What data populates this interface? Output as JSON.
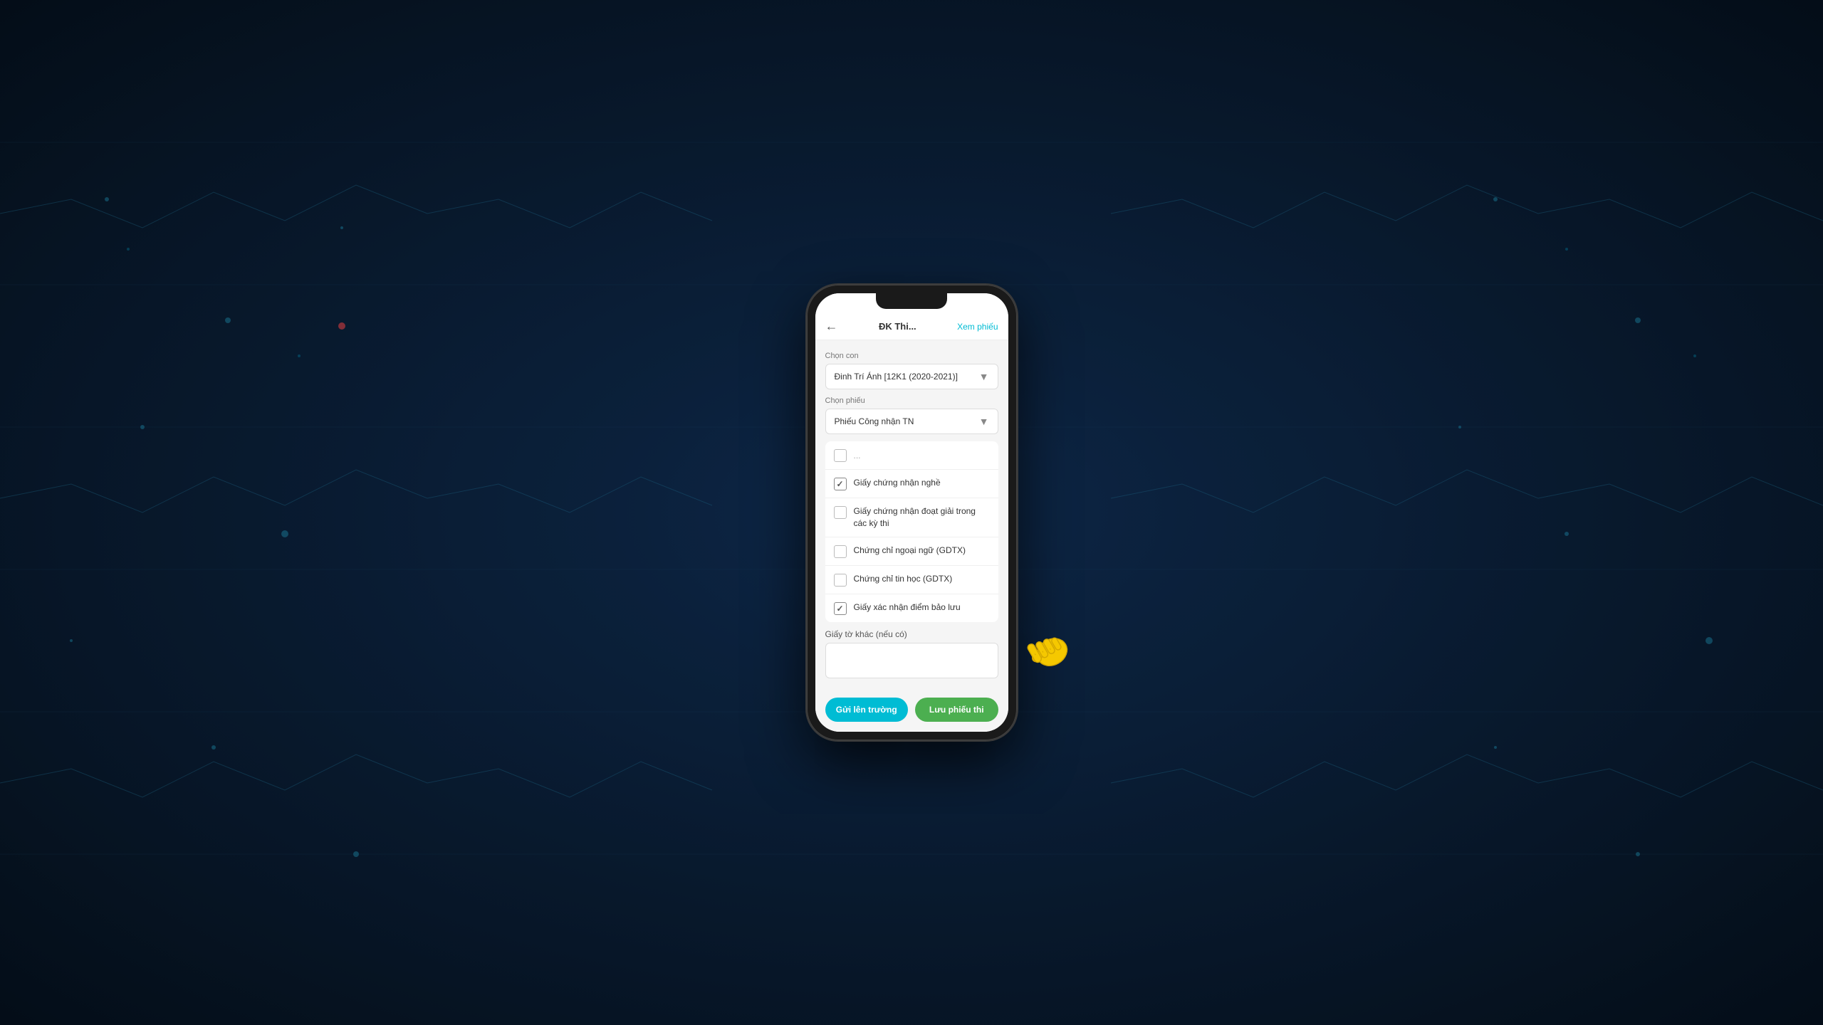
{
  "background": {
    "color_start": "#0d2040",
    "color_end": "#061018"
  },
  "phone": {
    "header": {
      "back_icon": "←",
      "title": "ĐK Thi...",
      "link_label": "Xem phiếu"
    },
    "chon_con": {
      "label": "Chọn con",
      "selected": "Đinh Trí Ánh [12K1 (2020-2021)]",
      "arrow": "▼"
    },
    "chon_phieu": {
      "label": "Chọn phiếu",
      "selected": "Phiếu Công nhận TN",
      "arrow": "▼"
    },
    "checklist": {
      "truncated_row": "...",
      "items": [
        {
          "id": "item1",
          "label": "Giấy chứng nhận nghề",
          "checked": true
        },
        {
          "id": "item2",
          "label": "Giấy chứng nhận đoạt giải trong các kỳ thi",
          "checked": false
        },
        {
          "id": "item3",
          "label": "Chứng chỉ ngoại ngữ (GDTX)",
          "checked": false
        },
        {
          "id": "item4",
          "label": "Chứng chỉ tin học (GDTX)",
          "checked": false
        },
        {
          "id": "item5",
          "label": "Giấy xác nhận điểm bảo lưu",
          "checked": true
        }
      ]
    },
    "other_docs": {
      "label": "Giấy tờ khác (nếu có)",
      "placeholder": ""
    },
    "buttons": {
      "send_label": "Gửi lên trường",
      "save_label": "Lưu phiếu thi"
    }
  }
}
